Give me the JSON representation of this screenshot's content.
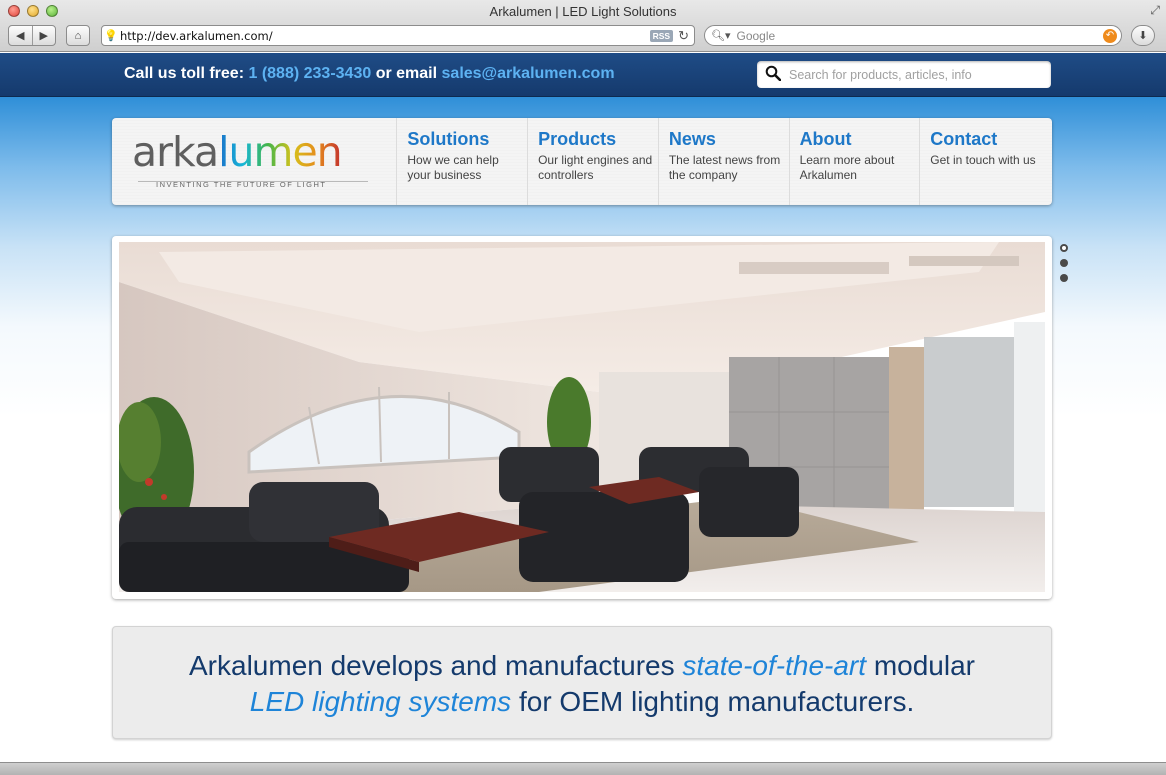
{
  "browser": {
    "window_title": "Arkalumen | LED Light Solutions",
    "url": "http://dev.arkalumen.com/",
    "rss_label": "RSS",
    "search_placeholder": "Google",
    "icons": [
      "back-icon",
      "forward-icon",
      "home-icon",
      "reload-icon",
      "search-icon",
      "download-icon",
      "resize-icon"
    ]
  },
  "topbar": {
    "call_label": "Call us toll free:",
    "phone": "1 (888) 233-3430",
    "or_email": "or email",
    "email": "sales@arkalumen.com",
    "search_placeholder": "Search for products, articles, info",
    "accent_color": "#5db2f2",
    "bar_color": "#1a4478"
  },
  "logo": {
    "part1": "arka",
    "part2": "lumen",
    "tagline": "INVENTING THE FUTURE OF LIGHT"
  },
  "nav": {
    "items": [
      {
        "title": "Solutions",
        "subtitle": "How we can help your business"
      },
      {
        "title": "Products",
        "subtitle": "Our light engines and controllers"
      },
      {
        "title": "News",
        "subtitle": "The latest news from the company"
      },
      {
        "title": "About",
        "subtitle": "Learn more about Arkalumen"
      },
      {
        "title": "Contact",
        "subtitle": "Get in touch with us"
      }
    ],
    "title_color": "#1e78c8"
  },
  "slider": {
    "active_index": 0,
    "count": 3
  },
  "intro": {
    "t1": "Arkalumen develops and manufactures",
    "h1": "state-of-the-art",
    "t2": "modular",
    "h2": "LED lighting systems",
    "t3": "for OEM lighting manufacturers.",
    "text_color": "#143a6c",
    "highlight_color": "#1e84d8"
  }
}
